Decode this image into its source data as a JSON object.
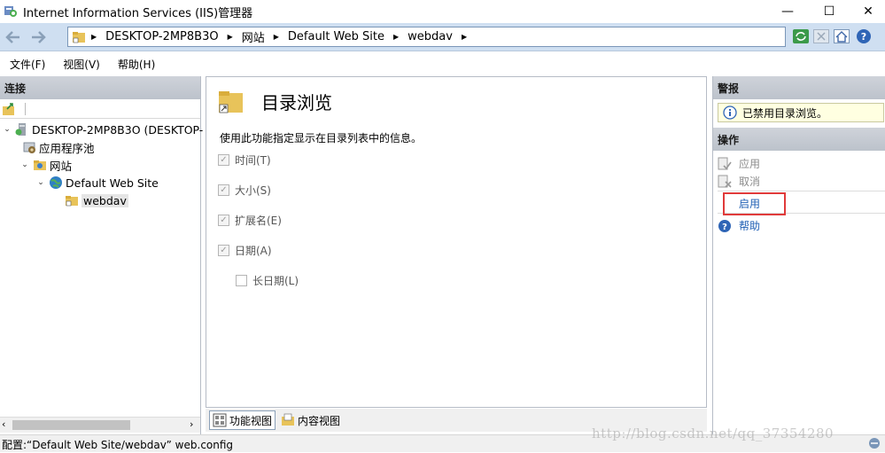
{
  "window": {
    "title": "Internet Information Services (IIS)管理器",
    "controls": [
      "—",
      "☐",
      "✕"
    ]
  },
  "address": {
    "crumbs": [
      "DESKTOP-2MP8B3O",
      "网站",
      "Default Web Site",
      "webdav"
    ]
  },
  "menu": [
    "文件(F)",
    "视图(V)",
    "帮助(H)"
  ],
  "connections": {
    "header": "连接",
    "tree": [
      {
        "label": "DESKTOP-2MP8B3O (DESKTOP-",
        "icon": "server-icon"
      },
      {
        "label": "应用程序池",
        "icon": "app-pool-icon"
      },
      {
        "label": "网站",
        "icon": "sites-folder-icon"
      },
      {
        "label": "Default Web Site",
        "icon": "globe-icon"
      },
      {
        "label": "webdav",
        "icon": "folder-shortcut-icon"
      }
    ]
  },
  "feature": {
    "title": "目录浏览",
    "description": "使用此功能指定显示在目录列表中的信息。",
    "options": [
      {
        "label": "时间(T)",
        "checked": true
      },
      {
        "label": "大小(S)",
        "checked": true
      },
      {
        "label": "扩展名(E)",
        "checked": true
      },
      {
        "label": "日期(A)",
        "checked": true
      },
      {
        "label": "长日期(L)",
        "checked": false
      }
    ]
  },
  "view_tabs": {
    "features": "功能视图",
    "content": "内容视图"
  },
  "alerts": {
    "header": "警报",
    "message": "已禁用目录浏览。"
  },
  "actions": {
    "header": "操作",
    "apply": "应用",
    "cancel": "取消",
    "enable": "启用",
    "help": "帮助"
  },
  "status": {
    "text": "配置:“Default Web Site/webdav” web.config"
  },
  "watermark": "http://blog.csdn.net/qq_37354280",
  "colors": {
    "accent": "#1f5fb4",
    "highlight": "#e03a3a",
    "alert_bg": "#ffffe1"
  }
}
